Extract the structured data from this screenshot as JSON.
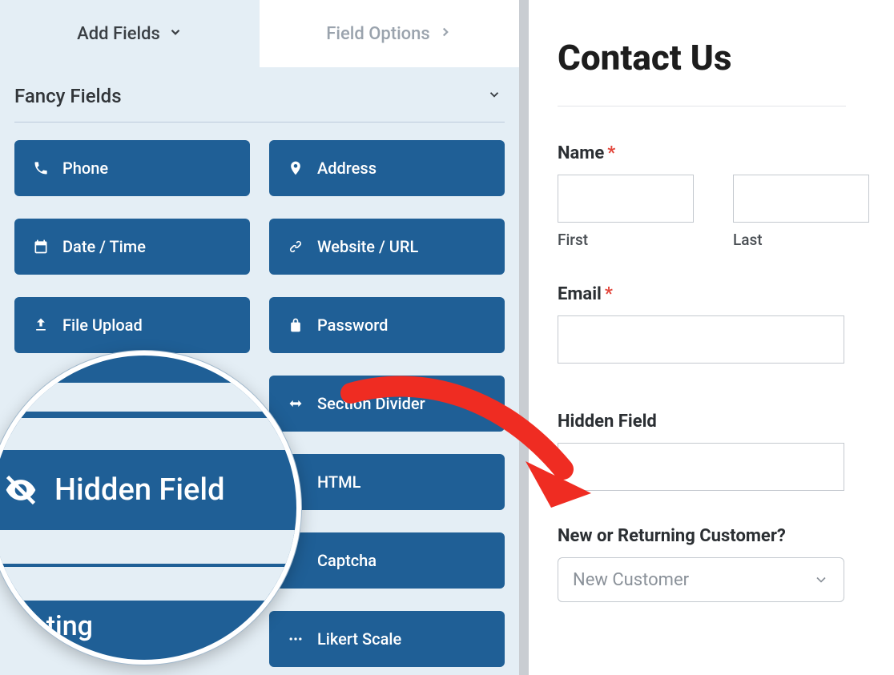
{
  "tabs": {
    "add_fields": "Add Fields",
    "field_options": "Field Options"
  },
  "section": {
    "title": "Fancy Fields"
  },
  "fields": {
    "phone": "Phone",
    "address": "Address",
    "datetime": "Date / Time",
    "website": "Website / URL",
    "fileupload": "File Upload",
    "password": "Password",
    "sectiondiv": "Section Divider",
    "html": "HTML",
    "captcha": "Captcha",
    "likert": "Likert Scale"
  },
  "zoom": {
    "hidden_field": "Hidden Field",
    "rating": "Rating"
  },
  "preview": {
    "title": "Contact Us",
    "name_label": "Name",
    "first": "First",
    "last": "Last",
    "email_label": "Email",
    "hidden_label": "Hidden Field",
    "customer_label": "New or Returning Customer?",
    "customer_value": "New Customer"
  }
}
